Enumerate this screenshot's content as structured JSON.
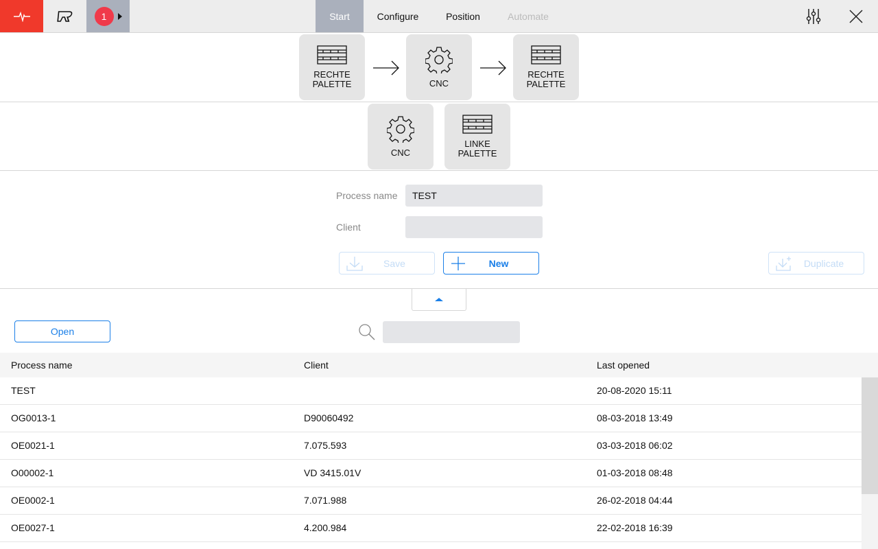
{
  "topbar": {
    "badge_count": "1",
    "tabs": [
      {
        "label": "Start",
        "active": true
      },
      {
        "label": "Configure"
      },
      {
        "label": "Position"
      },
      {
        "label": "Automate",
        "disabled": true
      }
    ],
    "colors": {
      "logo_bg": "#f0392b",
      "active_tab": "#aab0bc",
      "badge": "#f03a4a"
    }
  },
  "flow": {
    "row1": [
      {
        "label1": "RECHTE",
        "label2": "PALETTE",
        "icon": "pallet-icon"
      },
      {
        "label1": "CNC",
        "label2": "",
        "icon": "gear-icon"
      },
      {
        "label1": "RECHTE",
        "label2": "PALETTE",
        "icon": "pallet-icon"
      }
    ],
    "row2": [
      {
        "label1": "CNC",
        "label2": "",
        "icon": "gear-icon"
      },
      {
        "label1": "LINKE",
        "label2": "PALETTE",
        "icon": "pallet-icon"
      }
    ]
  },
  "form": {
    "process_name_label": "Process name",
    "process_name_value": "TEST",
    "client_label": "Client",
    "client_value": ""
  },
  "buttons": {
    "save": "Save",
    "new": "New",
    "duplicate": "Duplicate",
    "open": "Open"
  },
  "search": {
    "value": ""
  },
  "table": {
    "headers": [
      "Process name",
      "Client",
      "Last opened"
    ],
    "rows": [
      [
        "TEST",
        "",
        "20-08-2020  15:11"
      ],
      [
        "OG0013-1",
        "D90060492",
        "08-03-2018  13:49"
      ],
      [
        "OE0021-1",
        "7.075.593",
        "03-03-2018  06:02"
      ],
      [
        "O00002-1",
        "VD 3415.01V",
        "01-03-2018  08:48"
      ],
      [
        "OE0002-1",
        "7.071.988",
        "26-02-2018  04:44"
      ],
      [
        "OE0027-1",
        "4.200.984",
        "22-02-2018  16:39"
      ]
    ]
  }
}
